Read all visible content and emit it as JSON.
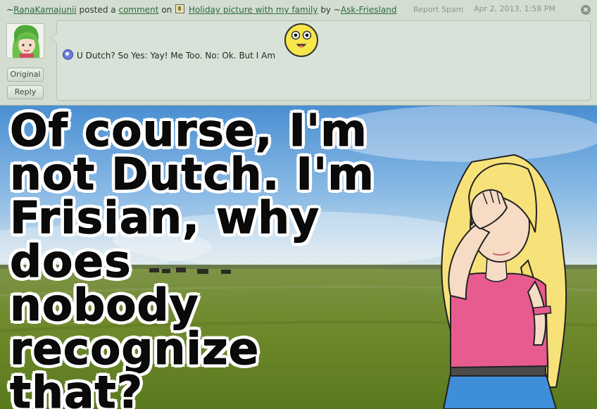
{
  "header": {
    "tilde_author": "~",
    "author": "RanaKamajunii",
    "posted_a": "posted a",
    "comment_link": "comment",
    "on": "on",
    "deviation_title": "Holiday picture with my family",
    "by": "by",
    "tilde_artist": "~",
    "artist": "Ask-Friesland",
    "report_spam": "Report Spam",
    "date": "Apr 2, 2013, 1:58 PM",
    "close_icon": "×"
  },
  "sidebar": {
    "original_label": "Original",
    "reply_label": "Reply"
  },
  "comment": {
    "text": "U Dutch? So Yes: Yay! Me Too. No: Ok. But I Am"
  },
  "picture": {
    "caption_line1": "Of course, I'm",
    "caption_line2": "not Dutch. I'm",
    "caption_line3": "Frisian, why does",
    "caption_line4": "nobody recognize",
    "caption_line5": "that?"
  },
  "colors": {
    "link": "#2e6b3c",
    "panel": "#d3ddd2",
    "sky": "#4f8fd0",
    "grass": "#6f8a2c"
  },
  "icons": {
    "close": "close-icon",
    "deviation": "deviation-icon",
    "message": "comment-emoticon-icon",
    "smiley": "smiley-emoticon-icon"
  }
}
